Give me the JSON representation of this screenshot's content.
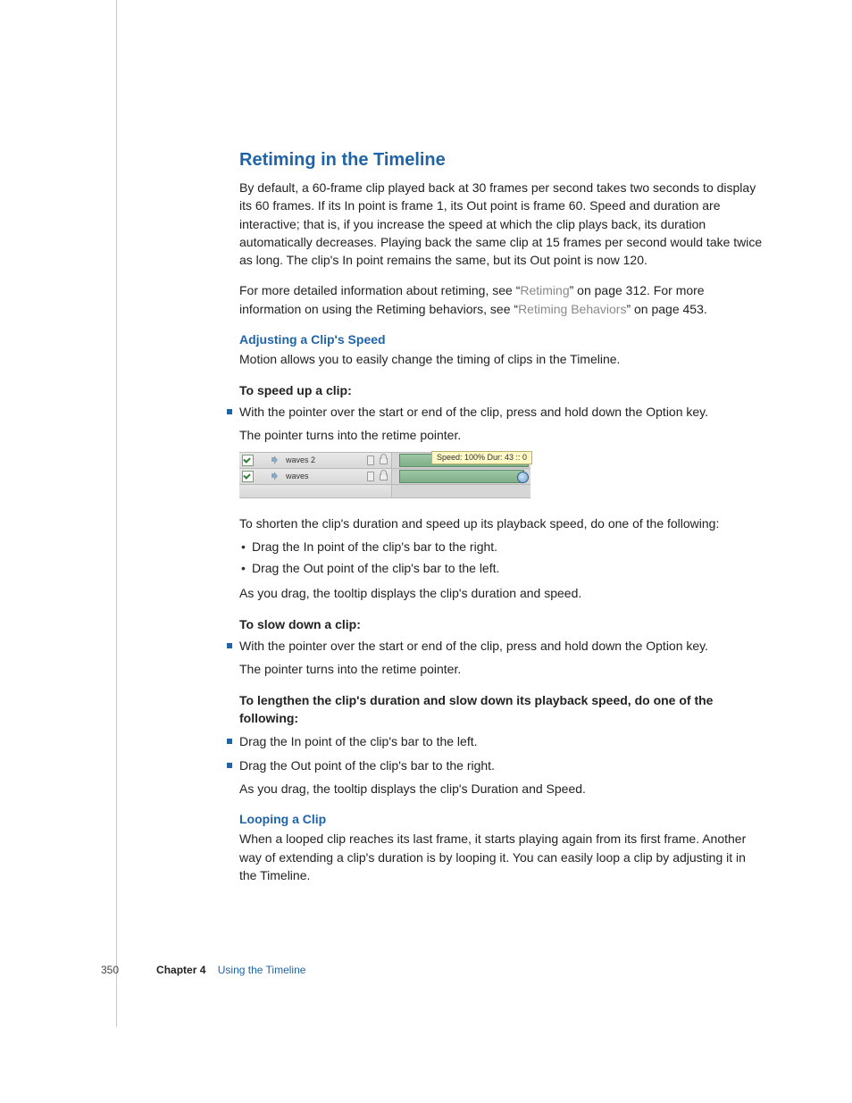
{
  "headings": {
    "main": "Retiming in the Timeline",
    "sub1": "Adjusting a Clip's Speed",
    "sub2": "Looping a Clip"
  },
  "paras": {
    "intro": "By default, a 60-frame clip played back at 30 frames per second takes two seconds to display its 60 frames. If its In point is frame 1, its Out point is frame 60. Speed and duration are interactive; that is, if you increase the speed at which the clip plays back, its duration automatically decreases. Playing back the same clip at 15 frames per second would take twice as long. The clip's In point remains the same, but its Out point is now 120.",
    "more1a": "For more detailed information about retiming, see “",
    "more1link": "Retiming",
    "more1b": "” on page 312. For more information on using the Retiming behaviors, see “",
    "more1link2": "Retiming Behaviors",
    "more1c": "” on page 453.",
    "adjintro": "Motion allows you to easily change the timing of clips in the Timeline.",
    "speedup_h": "To speed up a clip:",
    "speedup_b1": "With the pointer over the start or end of the clip, press and hold down the Option key.",
    "speedup_after1": "The pointer turns into the retime pointer.",
    "shorten_intro": "To shorten the clip's duration and speed up its playback speed, do one of the following:",
    "shorten_d1": "Drag the In point of the clip's bar to the right.",
    "shorten_d2": "Drag the Out point of the clip's bar to the left.",
    "shorten_after": "As you drag, the tooltip displays the clip's duration and speed.",
    "slow_h": "To slow down a clip:",
    "slow_b1": "With the pointer over the start or end of the clip, press and hold down the Option key.",
    "slow_after1": "The pointer turns into the retime pointer.",
    "lengthen_h": "To lengthen the clip's duration and slow down its playback speed, do one of the following:",
    "lengthen_b1": "Drag the In point of the clip's bar to the left.",
    "lengthen_b2": "Drag the Out point of the clip's bar to the right.",
    "lengthen_after": "As you drag, the tooltip displays the clip's Duration and Speed.",
    "loop": "When a looped clip reaches its last frame, it starts playing again from its first frame. Another way of extending a clip's duration is by looping it. You can easily loop a clip by adjusting it in the Timeline."
  },
  "mock": {
    "row1_name": "waves 2",
    "row2_name": "waves",
    "tooltip": "Speed: 100% Dur: 43 :: 0"
  },
  "footer": {
    "page": "350",
    "chapter": "Chapter 4",
    "title": "Using the Timeline"
  }
}
